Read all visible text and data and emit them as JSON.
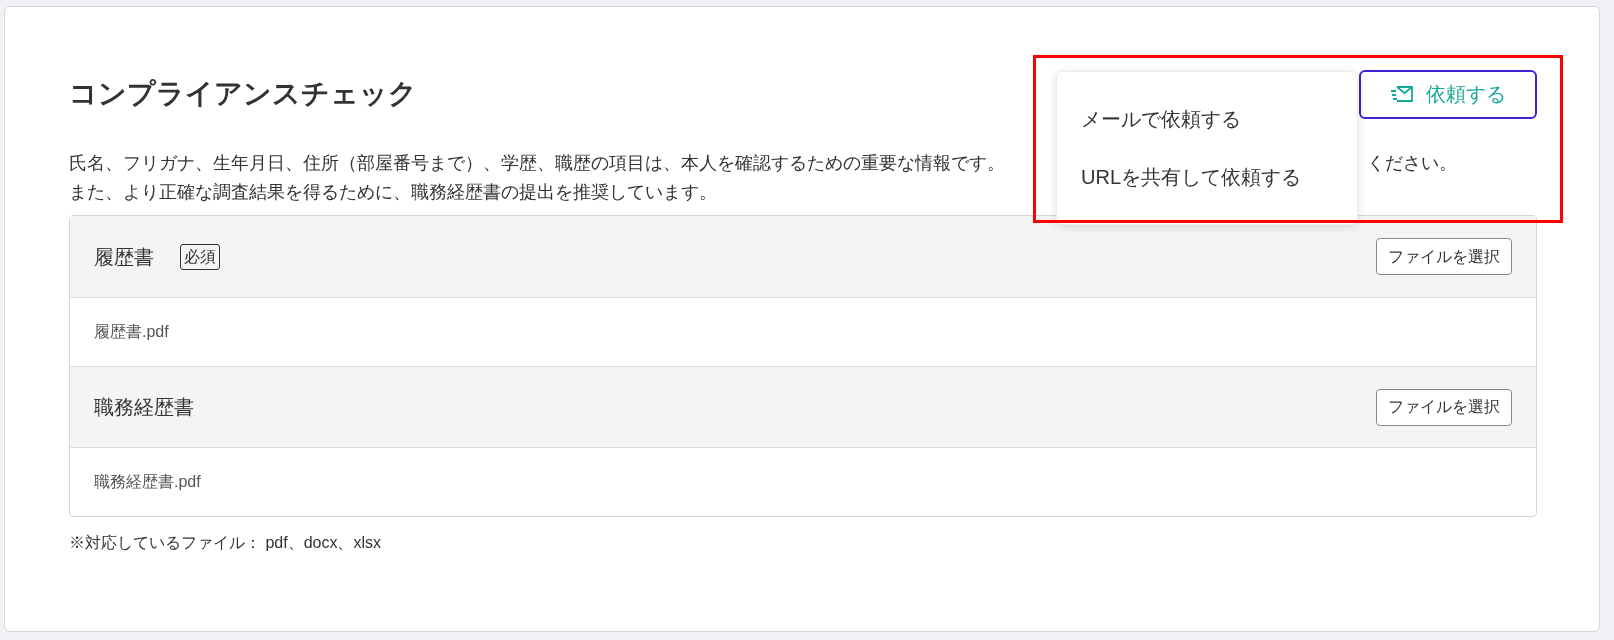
{
  "title": "コンプライアンスチェック",
  "request_button": {
    "label": "依頼する"
  },
  "request_menu": {
    "items": [
      {
        "label": "メールで依頼する"
      },
      {
        "label": "URLを共有して依頼する"
      }
    ]
  },
  "description": {
    "line_1_start": "氏名、フリガナ、生年月日、住所（部屋番号まで）、学歴、職歴の項目は、本人を確認するための重要な情報です。",
    "line_1_end": "ください。",
    "line_2": "また、より正確な調査結果を得るために、職務経歴書の提出を推奨しています。"
  },
  "documents": [
    {
      "title": "履歴書",
      "badge": "必須",
      "button": "ファイルを選択",
      "file": "履歴書.pdf"
    },
    {
      "title": "職務経歴書",
      "button": "ファイルを選択",
      "file": "職務経歴書.pdf"
    }
  ],
  "note": "※対応しているファイル： pdf、docx、xlsx"
}
